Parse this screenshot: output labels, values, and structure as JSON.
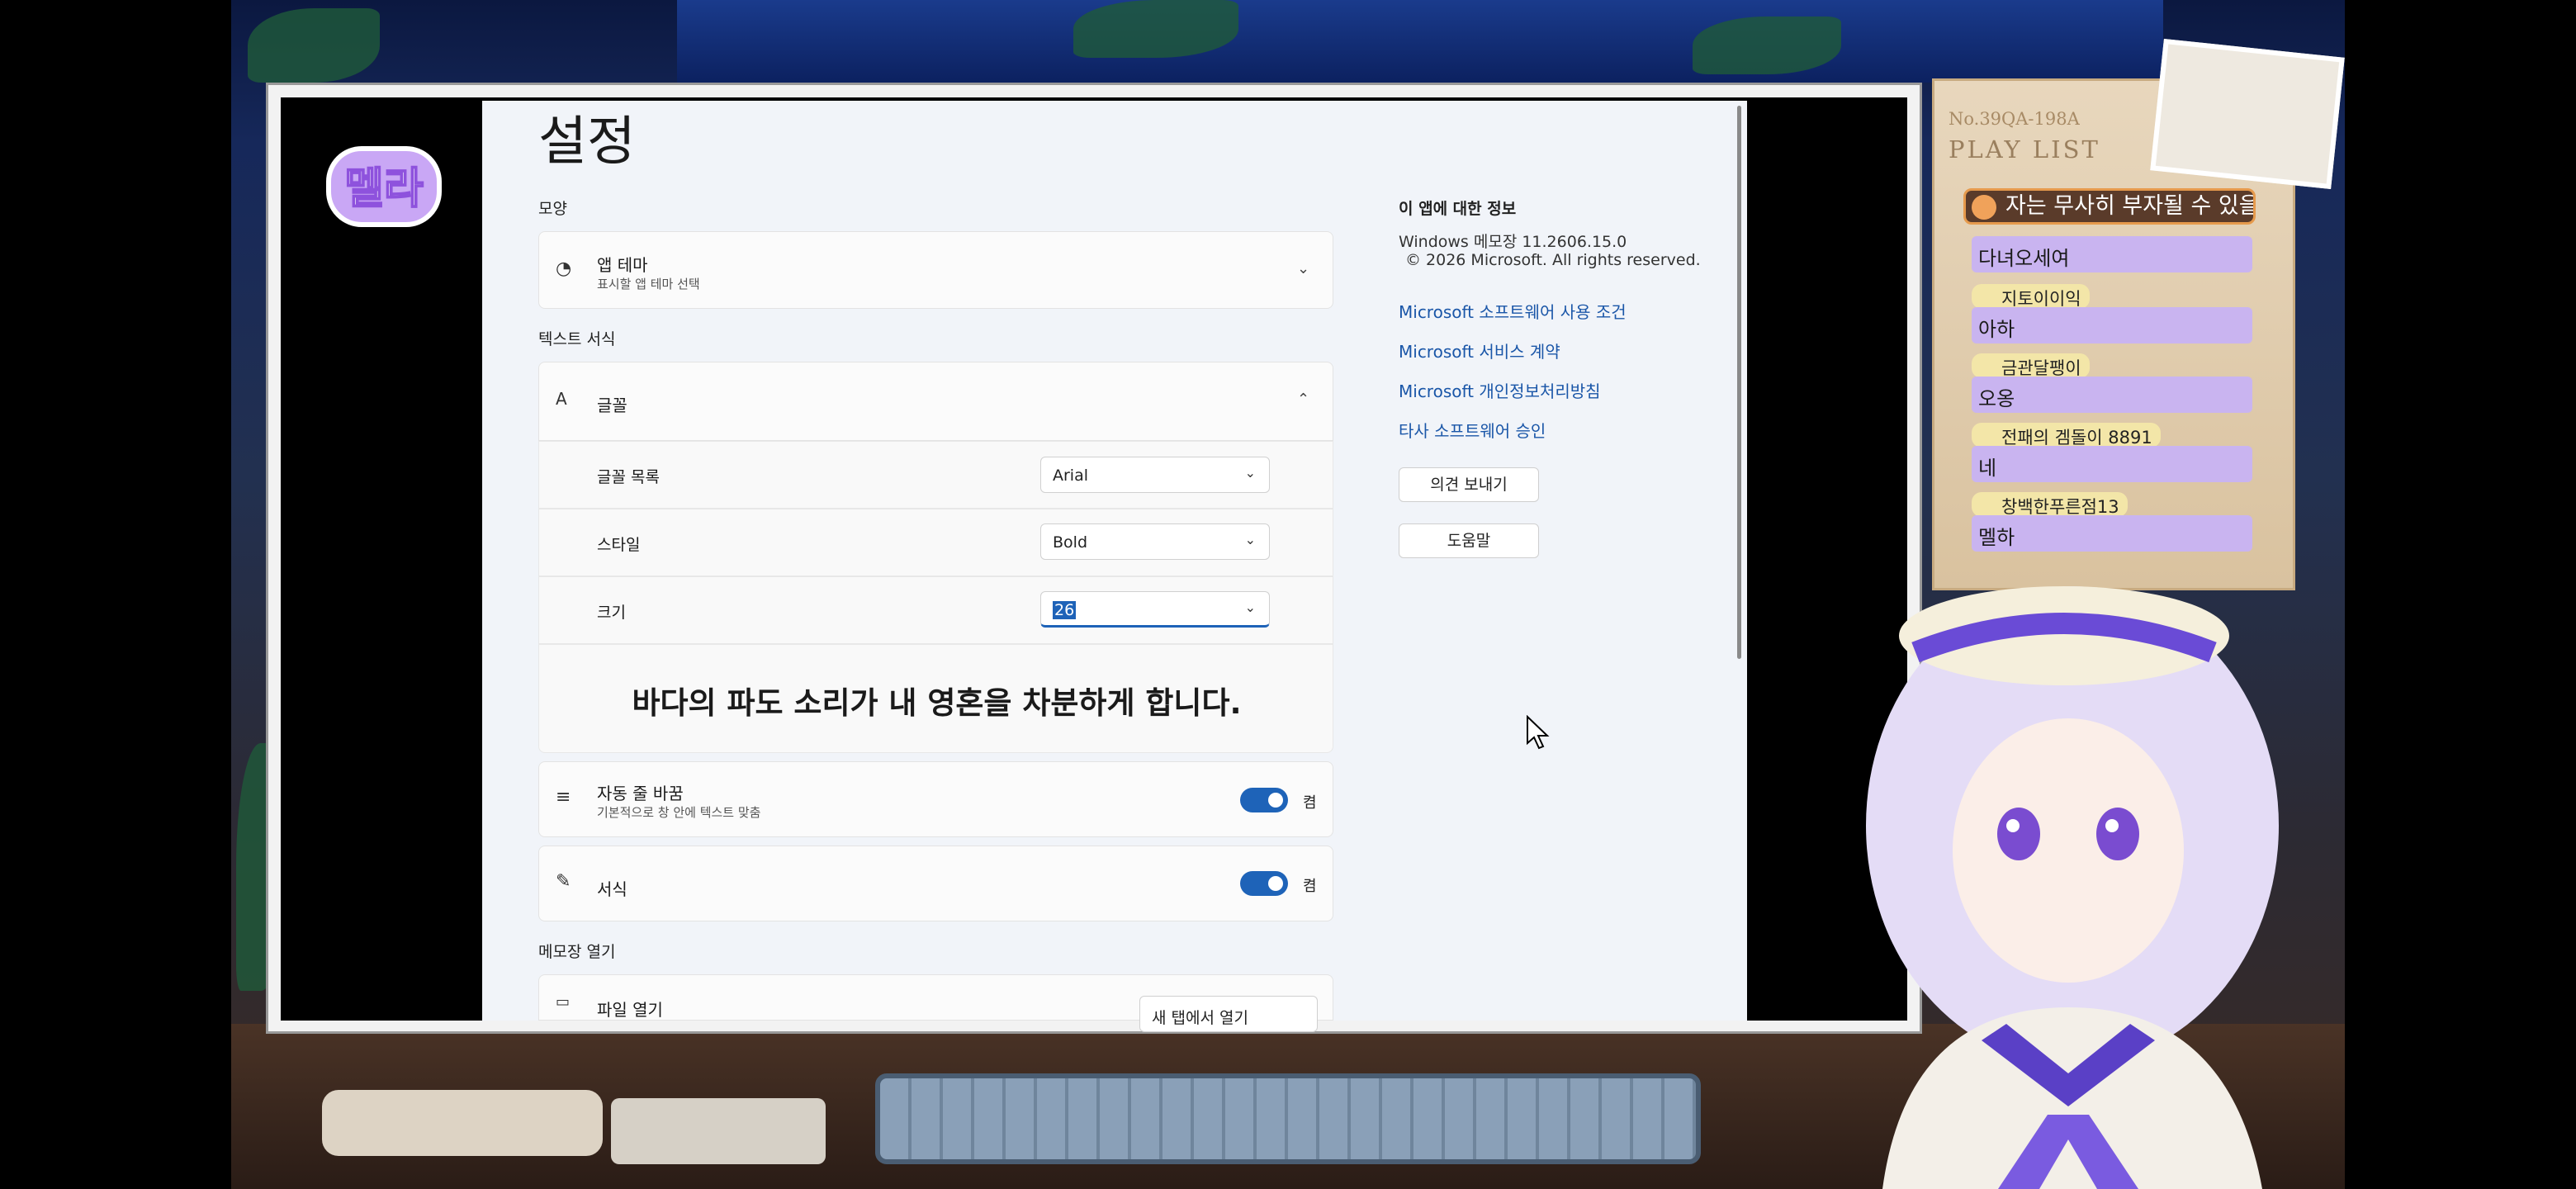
{
  "settings": {
    "title": "설정",
    "appearance_label": "모양",
    "app_theme": {
      "title": "앱 테마",
      "subtitle": "표시할 앱 테마 선택"
    },
    "text_format_label": "텍스트 서식",
    "font_section": {
      "title": "글꼴"
    },
    "font_family": {
      "label": "글꼴 목록",
      "value": "Arial"
    },
    "font_style": {
      "label": "스타일",
      "value": "Bold"
    },
    "font_size": {
      "label": "크기",
      "value": "26"
    },
    "preview_text": "바다의 파도 소리가 내 영혼을 차분하게 합니다.",
    "word_wrap": {
      "title": "자동 줄 바꿈",
      "subtitle": "기본적으로 창 안에 텍스트 맞춤",
      "state": "켬"
    },
    "formatting": {
      "title": "서식",
      "state": "켬"
    },
    "open_notepad_label": "메모장 열기",
    "open_file": {
      "title": "파일 열기",
      "value": "새 탭에서 열기"
    }
  },
  "about": {
    "title": "이 앱에 대한 정보",
    "version": "Windows 메모장 11.2606.15.0",
    "copyright": "© 2026 Microsoft. All rights reserved.",
    "links": [
      "Microsoft 소프트웨어 사용 조건",
      "Microsoft 서비스 계약",
      "Microsoft 개인정보처리방침",
      "타사 소프트웨어 승인"
    ],
    "feedback_button": "의견 보내기",
    "help_button": "도움말"
  },
  "stream": {
    "logo_text": "멜라",
    "playlist_no": "No.39QA-198A",
    "playlist_title": "PLAY LIST",
    "now_playing": "자는 무사히 부자될 수 있을",
    "chat": [
      {
        "name": "",
        "msg": "다녀오세여"
      },
      {
        "name": "지토이이익",
        "msg": "아하"
      },
      {
        "name": "금관달팽이",
        "msg": "오옹"
      },
      {
        "name": "전패의 겜돌이 8891",
        "msg": "네"
      },
      {
        "name": "창백한푸른점13",
        "msg": "멜하"
      }
    ]
  },
  "colors": {
    "accent": "#1e63b8",
    "link": "#1a56a8",
    "chat_bubble": "#c9b4f0",
    "chat_name": "#f3e6a8",
    "logo_purple": "#a974e8"
  },
  "icons": [
    "palette-icon",
    "font-icon",
    "wrap-icon",
    "format-icon",
    "file-open-icon",
    "chevron-down-icon",
    "chevron-up-icon"
  ]
}
